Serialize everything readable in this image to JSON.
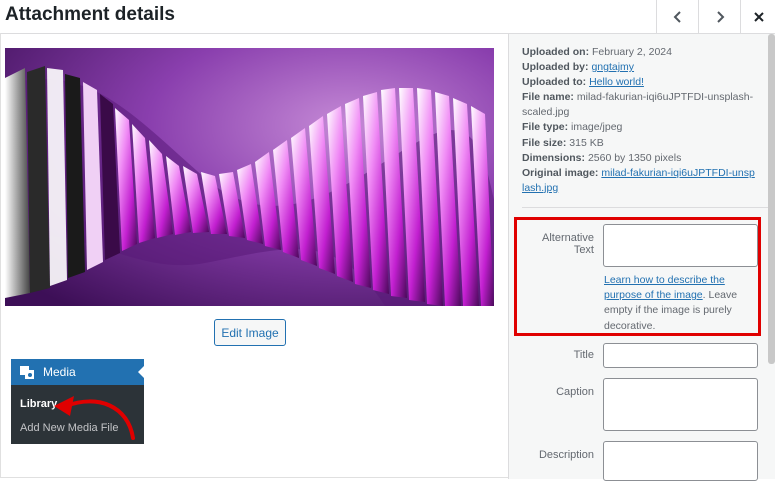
{
  "header": {
    "title": "Attachment details"
  },
  "icons": {
    "prev": "chevron-left-icon",
    "next": "chevron-right-icon",
    "close": "close-icon",
    "media": "media-icon"
  },
  "preview": {
    "edit_label": "Edit Image"
  },
  "admin_menu": {
    "title": "Media",
    "library": "Library",
    "add_new": "Add New Media File"
  },
  "details": {
    "uploaded_on_label": "Uploaded on:",
    "uploaded_on": "February 2, 2024",
    "uploaded_by_label": "Uploaded by:",
    "uploaded_by": "gngtajmy",
    "uploaded_to_label": "Uploaded to:",
    "uploaded_to": "Hello world!",
    "file_name_label": "File name:",
    "file_name": "milad-fakurian-iqi6uJPTFDI-unsplash-scaled.jpg",
    "file_type_label": "File type:",
    "file_type": "image/jpeg",
    "file_size_label": "File size:",
    "file_size": "315 KB",
    "dimensions_label": "Dimensions:",
    "dimensions": "2560 by 1350 pixels",
    "original_label": "Original image:",
    "original": "milad-fakurian-iqi6uJPTFDI-unsplash.jpg"
  },
  "fields": {
    "alt_label": "Alternative Text",
    "alt_value": "",
    "alt_help_link": "Learn how to describe the purpose of the image",
    "alt_help_rest": ". Leave empty if the image is purely decorative.",
    "title_label": "Title",
    "title_value": "",
    "caption_label": "Caption",
    "caption_value": "",
    "description_label": "Description",
    "description_value": ""
  },
  "colors": {
    "accent": "#2271b1",
    "highlight": "#e00000",
    "menu_bg": "#2c3338"
  }
}
